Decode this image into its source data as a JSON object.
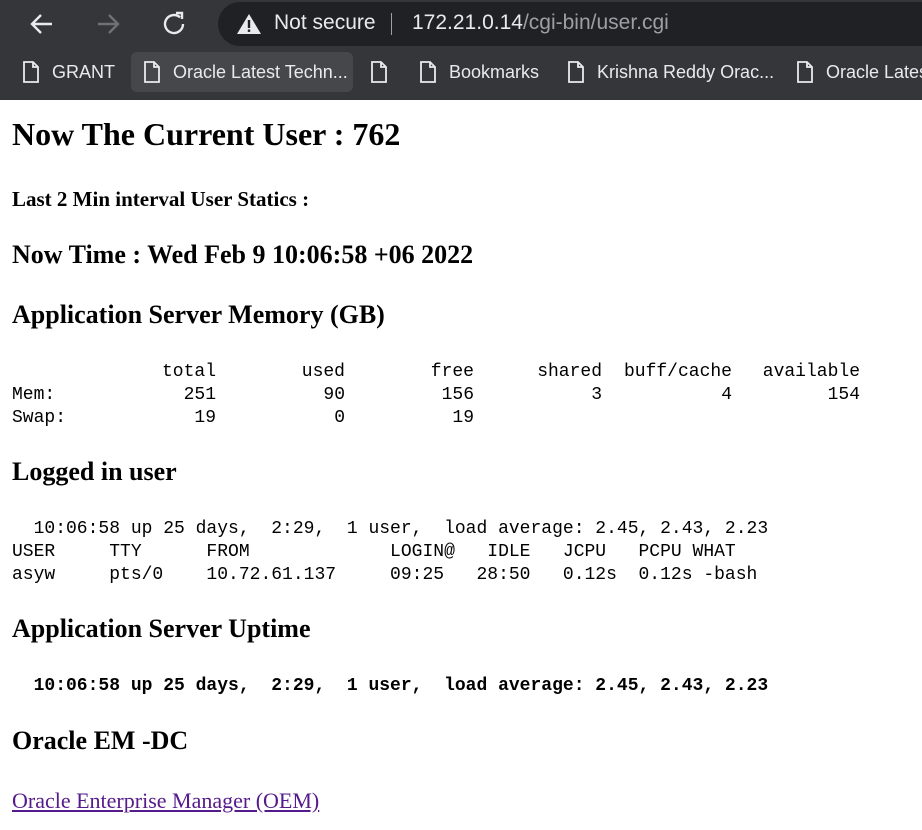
{
  "browser": {
    "security_label": "Not secure",
    "url_host": "172.21.0.14",
    "url_path": "/cgi-bin/user.cgi",
    "bookmarks": [
      {
        "label": "GRANT"
      },
      {
        "label": "Oracle Latest Techn..."
      },
      {
        "label": ""
      },
      {
        "label": "Bookmarks"
      },
      {
        "label": "Krishna Reddy Orac..."
      },
      {
        "label": "Oracle Lates"
      }
    ]
  },
  "page": {
    "current_user": "Now The Current User : 762",
    "stat_heading": "Last 2 Min interval User Statics :",
    "now_time": "Now Time : Wed Feb 9 10:06:58 +06 2022",
    "memory": {
      "heading": "Application Server Memory (GB)",
      "columns": [
        "total",
        "used",
        "free",
        "shared",
        "buff/cache",
        "available"
      ],
      "rows": [
        {
          "label": "Mem:",
          "values": [
            "251",
            "90",
            "156",
            "3",
            "4",
            "154"
          ]
        },
        {
          "label": "Swap:",
          "values": [
            "19",
            "0",
            "19",
            "",
            "",
            ""
          ]
        }
      ]
    },
    "logged_in": {
      "heading": "Logged in user",
      "uptime_line": "  10:06:58 up 25 days,  2:29,  1 user,  load average: 2.45, 2.43, 2.23",
      "header_line": "USER     TTY      FROM             LOGIN@   IDLE   JCPU   PCPU WHAT",
      "user_line": "asyw     pts/0    10.72.61.137     09:25   28:50   0.12s  0.12s -bash"
    },
    "uptime": {
      "heading": "Application Server Uptime",
      "line": "  10:06:58 up 25 days,  2:29,  1 user,  load average: 2.45, 2.43, 2.23"
    },
    "oem": {
      "heading": "Oracle EM -DC",
      "link_text": "Oracle Enterprise Manager (OEM)"
    }
  },
  "colors": {
    "chrome": "#35363a",
    "omnibox": "#202124",
    "visited_link": "#551a8b"
  }
}
